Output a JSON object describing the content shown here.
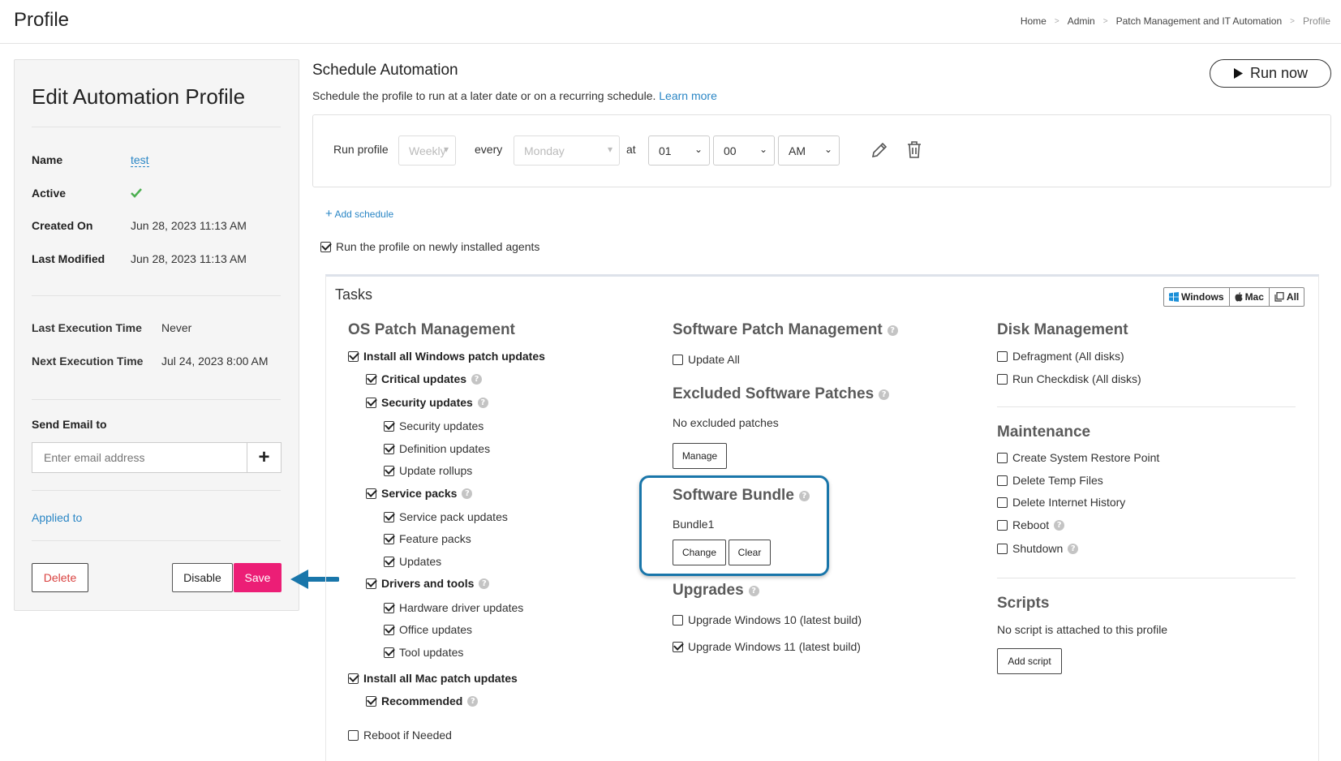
{
  "header": {
    "title": "Profile",
    "breadcrumbs": [
      "Home",
      "Admin",
      "Patch Management and IT Automation",
      "Profile"
    ]
  },
  "left_panel": {
    "title": "Edit Automation Profile",
    "name_label": "Name",
    "name_value": "test",
    "active_label": "Active",
    "created_label": "Created On",
    "created_value": "Jun 28, 2023 11:13 AM",
    "modified_label": "Last Modified",
    "modified_value": "Jun 28, 2023 11:13 AM",
    "last_exec_label": "Last Execution Time",
    "last_exec_value": "Never",
    "next_exec_label": "Next Execution Time",
    "next_exec_value": "Jul 24, 2023 8:00 AM",
    "send_email_label": "Send Email to",
    "email_placeholder": "Enter email address",
    "applied_to": "Applied to",
    "delete_label": "Delete",
    "disable_label": "Disable",
    "save_label": "Save"
  },
  "schedule": {
    "title": "Schedule Automation",
    "subtitle": "Schedule the profile to run at a later date or on a recurring schedule.",
    "learn_more": "Learn more",
    "run_now": "Run now",
    "run_profile": "Run profile",
    "frequency": "Weekly",
    "every": "every",
    "day": "Monday",
    "at": "at",
    "hour": "01",
    "minute": "00",
    "ampm": "AM",
    "add_schedule": "Add schedule",
    "newly_installed": "Run the profile on newly installed agents"
  },
  "tasks": {
    "title": "Tasks",
    "os_tabs": [
      "Windows",
      "Mac",
      "All"
    ],
    "os_patch": {
      "heading": "OS Patch Management",
      "install_windows": "Install all Windows patch updates",
      "critical": "Critical updates",
      "security": "Security updates",
      "security_sub": [
        "Security updates",
        "Definition updates",
        "Update rollups"
      ],
      "service_packs": "Service packs",
      "service_sub": [
        "Service pack updates",
        "Feature packs",
        "Updates"
      ],
      "drivers": "Drivers and tools",
      "drivers_sub": [
        "Hardware driver updates",
        "Office updates",
        "Tool updates"
      ],
      "install_mac": "Install all Mac patch updates",
      "recommended": "Recommended",
      "reboot": "Reboot if Needed"
    },
    "software_patch": {
      "heading": "Software Patch Management",
      "update_all": "Update All",
      "excluded_heading": "Excluded Software Patches",
      "no_excluded": "No excluded patches",
      "manage": "Manage"
    },
    "software_bundle": {
      "heading": "Software Bundle",
      "bundle_name": "Bundle1",
      "change": "Change",
      "clear": "Clear"
    },
    "upgrades": {
      "heading": "Upgrades",
      "win10": "Upgrade Windows 10 (latest build)",
      "win11": "Upgrade Windows 11 (latest build)"
    },
    "disk": {
      "heading": "Disk Management",
      "defrag": "Defragment (All disks)",
      "checkdisk": "Run Checkdisk (All disks)"
    },
    "maintenance": {
      "heading": "Maintenance",
      "items": [
        "Create System Restore Point",
        "Delete Temp Files",
        "Delete Internet History",
        "Reboot",
        "Shutdown"
      ]
    },
    "scripts": {
      "heading": "Scripts",
      "none": "No script is attached to this profile",
      "add": "Add script"
    }
  },
  "colors": {
    "accent": "#ec1e76",
    "link": "#2a86c5",
    "highlight": "#1976aa",
    "active_check": "#4caf50"
  }
}
